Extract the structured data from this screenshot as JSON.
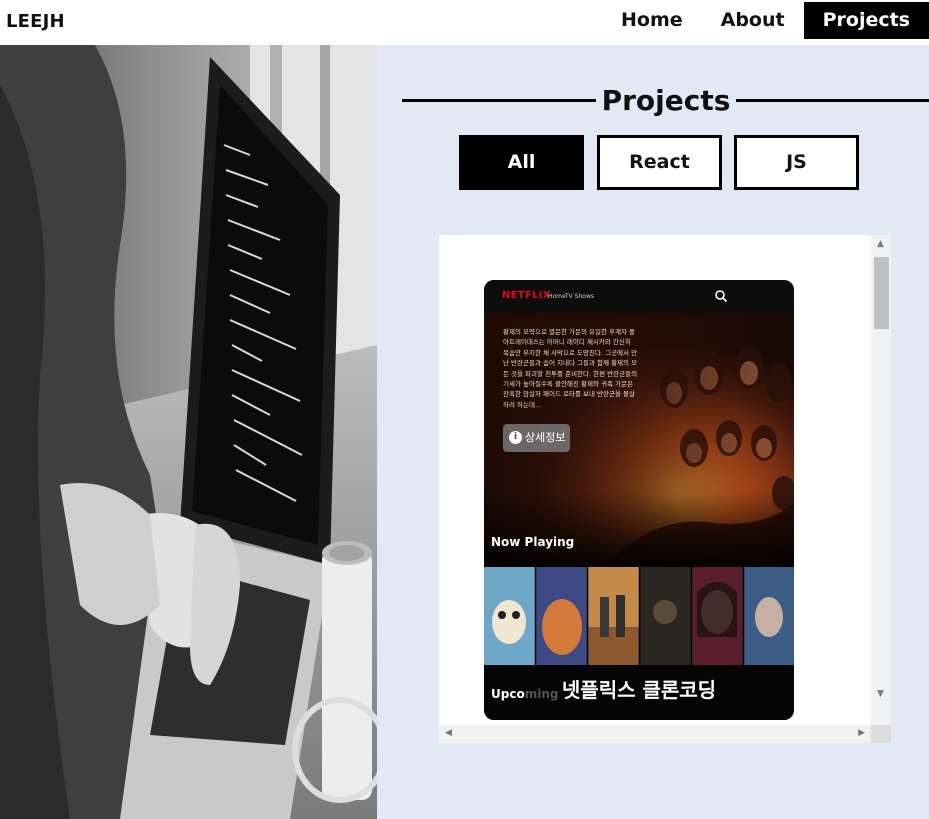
{
  "nav": {
    "logo": "LEEJH",
    "links": [
      {
        "label": "Home",
        "active": false
      },
      {
        "label": "About",
        "active": false
      },
      {
        "label": "Projects",
        "active": true
      }
    ]
  },
  "section": {
    "title": "Projects"
  },
  "filters": [
    {
      "label": "All",
      "active": true
    },
    {
      "label": "React",
      "active": false
    },
    {
      "label": "JS",
      "active": false
    }
  ],
  "project": {
    "title": "넷플릭스 클론코딩",
    "preview": {
      "logo": "NETFLIX",
      "nav_home": "Home",
      "nav_tv": "TV Shows",
      "overview": "황제의 모략으로 멸문한 가문의 유일한 후계자 폴 아트레이데스는 어머니 레이디 제시카와 간신히 목숨만 부지한 채 사막으로 도망친다. 그곳에서 만난 반란군들과 숨어 지내다 그들과 함께 황제의 모든 것을 파괴할 전투를 준비한다. 한편 반란군들의 기세가 높아질수록 불안해진 황제와 귀족 가문은 잔혹한 암살자 페이드 로타를 보내 반란군을 몰살하려 하는데...",
      "detail_button": "상세정보",
      "info_icon": "i",
      "now_playing": "Now Playing",
      "upcoming": "Upco",
      "upcoming_fade": "ming"
    }
  },
  "colors": {
    "page_bg": "#e2e9f4",
    "nav_active_bg": "#000000",
    "netflix_red": "#e50914"
  }
}
